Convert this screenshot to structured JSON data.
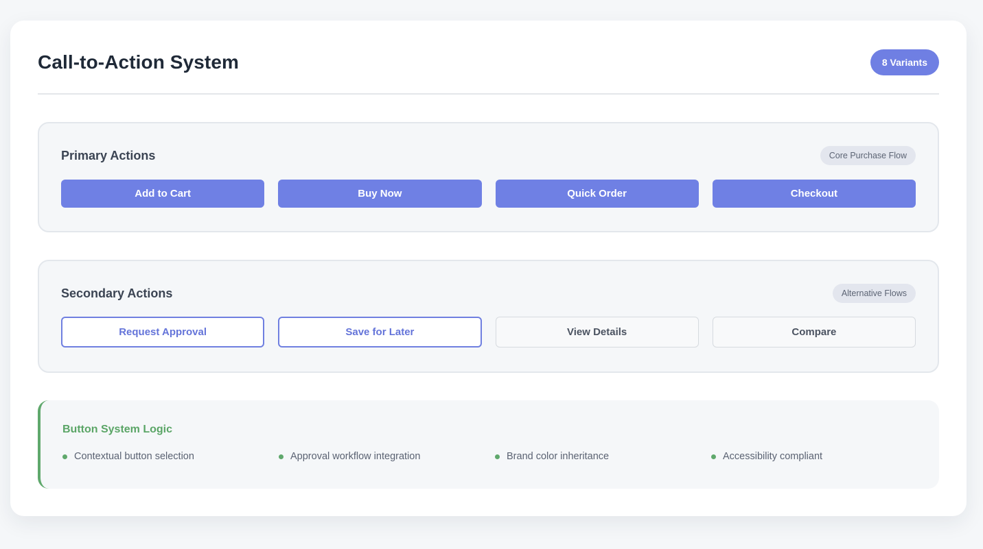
{
  "header": {
    "title": "Call-to-Action System",
    "badge": "8 Variants"
  },
  "primary": {
    "title": "Primary Actions",
    "tag": "Core Purchase Flow",
    "buttons": [
      "Add to Cart",
      "Buy Now",
      "Quick Order",
      "Checkout"
    ]
  },
  "secondary": {
    "title": "Secondary Actions",
    "tag": "Alternative Flows",
    "buttons": [
      "Request Approval",
      "Save for Later",
      "View Details",
      "Compare"
    ]
  },
  "logic": {
    "title": "Button System Logic",
    "items": [
      "Contextual button selection",
      "Approval workflow integration",
      "Brand color inheritance",
      "Accessibility compliant"
    ]
  },
  "colors": {
    "accent": "#6f80e4",
    "success": "#5fa86c",
    "background": "#f5f7f9"
  }
}
